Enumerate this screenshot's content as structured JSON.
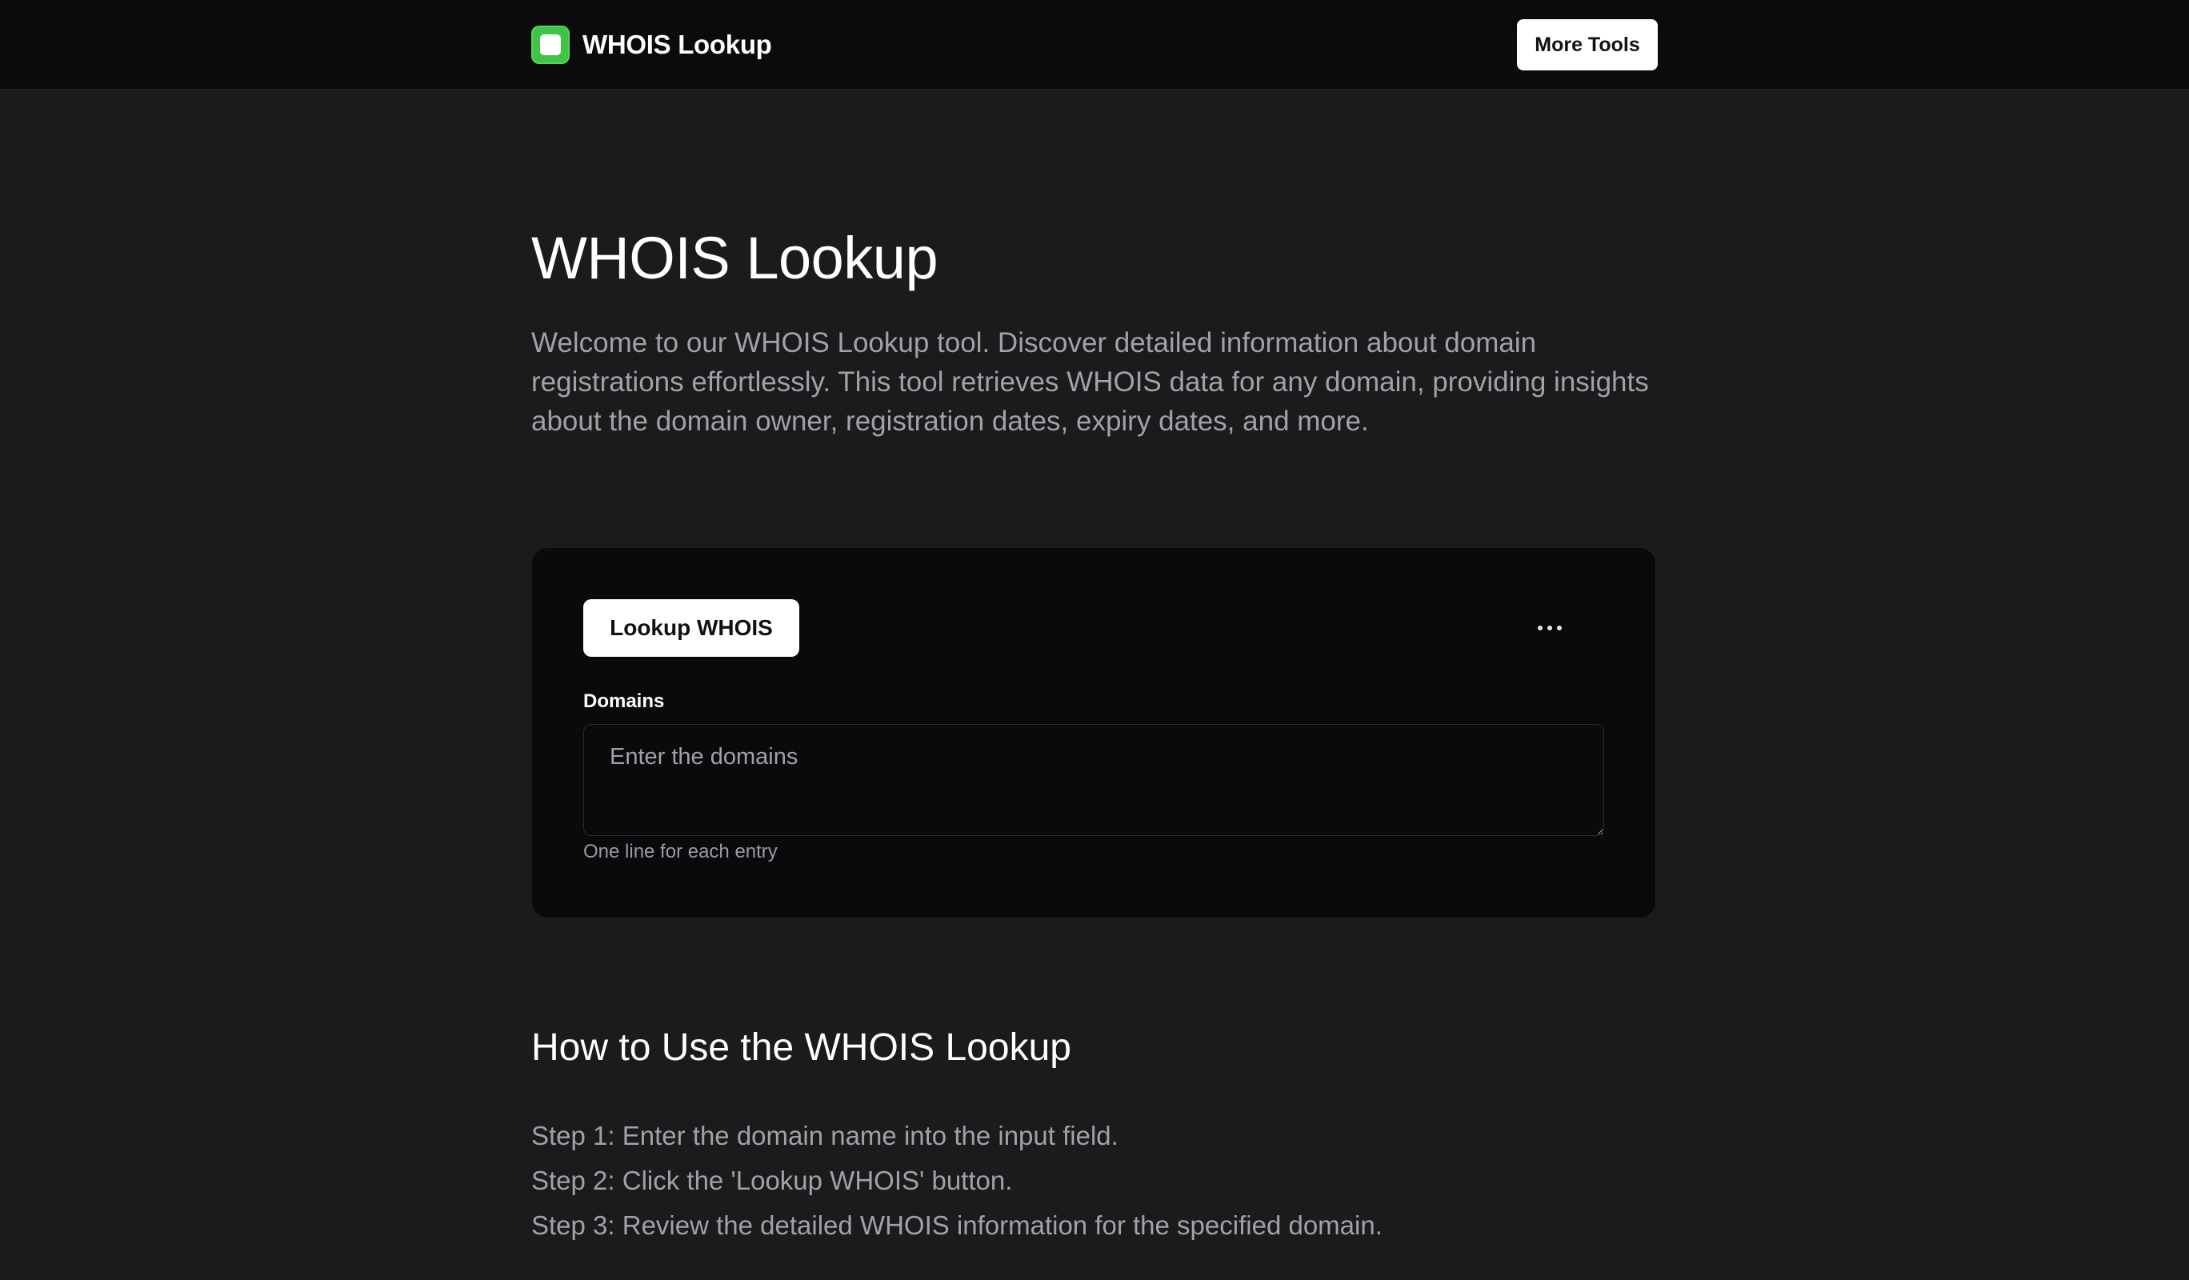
{
  "header": {
    "brand_name": "WHOIS Lookup",
    "logo_icon": "app-square-icon",
    "more_tools_label": "More Tools"
  },
  "hero": {
    "title": "WHOIS Lookup",
    "description": "Welcome to our WHOIS Lookup tool. Discover detailed information about domain registrations effortlessly. This tool retrieves WHOIS data for any domain, providing insights about the domain owner, registration dates, expiry dates, and more."
  },
  "tool": {
    "lookup_button_label": "Lookup WHOIS",
    "menu_icon": "more-horizontal-icon",
    "domains_label": "Domains",
    "domains_value": "",
    "domains_placeholder": "Enter the domains",
    "domains_hint": "One line for each entry"
  },
  "how_to": {
    "title": "How to Use the WHOIS Lookup",
    "steps": [
      "Step 1: Enter the domain name into the input field.",
      "Step 2: Click the 'Lookup WHOIS' button.",
      "Step 3: Review the detailed WHOIS information for the specified domain."
    ]
  },
  "colors": {
    "accent_green": "#3fc447",
    "background": "#1b1b1d",
    "header_bg": "#0b0b0d",
    "card_bg": "#0a0a0c"
  }
}
